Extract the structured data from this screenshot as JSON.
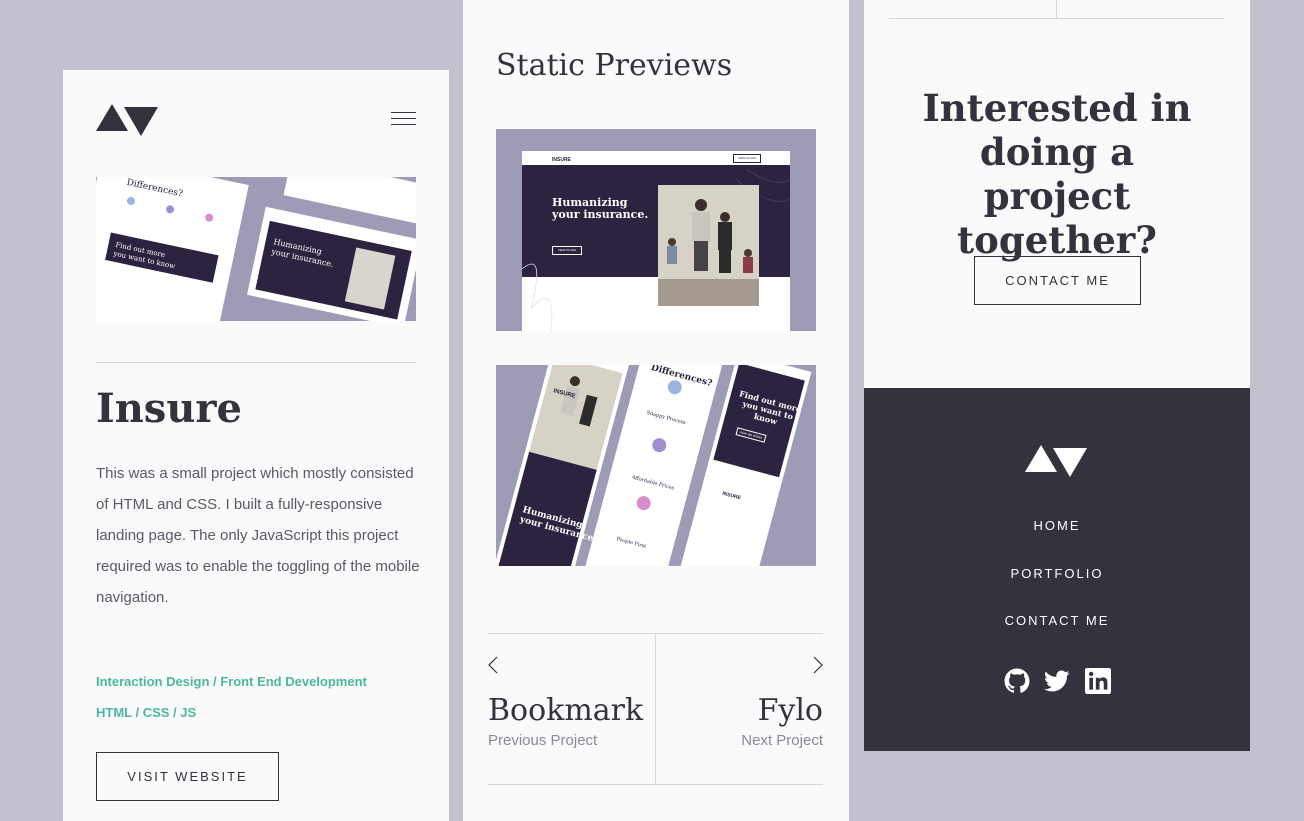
{
  "header": {
    "logo": "av-logo-icon",
    "menu_icon": "hamburger-icon"
  },
  "project": {
    "title": "Insure",
    "description": "This was a small project which mostly consisted of HTML and CSS. I built a fully-responsive landing page. The only JavaScript this project required was to enable the toggling of the mobile navigation.",
    "skills": "Interaction Design / Front End Development",
    "tech": "HTML / CSS / JS",
    "visit_label": "VISIT WEBSITE"
  },
  "previews": {
    "title": "Static Previews",
    "desktop": {
      "brand": "INSURE",
      "headline_line1": "Humanizing",
      "headline_line2": "your insurance.",
      "cta": "VIEW PLANS",
      "nav_button": "VIEW PLANS"
    },
    "mobile": {
      "brand": "INSURE",
      "headline_line1": "Humanizing",
      "headline_line2": "your insurance.",
      "differences": "Differences?",
      "feature1": "Snappy Process",
      "feature2": "Affordable Prices",
      "feature3": "People First",
      "find_out_line1": "Find out more",
      "find_out_line2": "you want to",
      "find_out_line3": "know",
      "how_button": "HOW WE WORK",
      "footer_brand": "INSURE"
    }
  },
  "project_nav": {
    "prev_name": "Bookmark",
    "prev_label": "Previous Project",
    "next_name": "Fylo",
    "next_label": "Next Project"
  },
  "cta": {
    "title": "Interested in doing a project together?",
    "button": "CONTACT ME"
  },
  "footer": {
    "links": [
      "HOME",
      "PORTFOLIO",
      "CONTACT ME"
    ],
    "social": [
      "github-icon",
      "twitter-icon",
      "linkedin-icon"
    ]
  },
  "colors": {
    "background": "#c2c1ce",
    "panel": "#fafafa",
    "dark": "#33323d",
    "accent": "#4ab8a1",
    "preview_bg": "#9d9bb5",
    "insure_purple": "#2c2340"
  }
}
